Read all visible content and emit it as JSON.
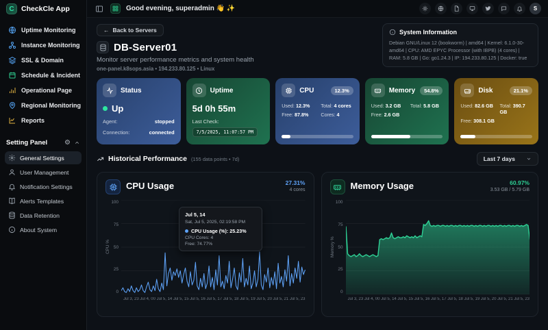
{
  "app": {
    "title": "CheckCle App"
  },
  "header": {
    "greeting": "Good evening, superadmin 👋 ✨",
    "avatar_initial": "S"
  },
  "icons": {
    "back_arrow": "←",
    "gear": "⚙"
  },
  "sidebar": {
    "items": [
      {
        "label": "Uptime Monitoring"
      },
      {
        "label": "Instance Monitoring"
      },
      {
        "label": "SSL & Domain"
      },
      {
        "label": "Schedule & Incident"
      },
      {
        "label": "Operational Page"
      },
      {
        "label": "Regional Monitoring"
      },
      {
        "label": "Reports"
      }
    ],
    "settings_label": "Setting Panel",
    "settings_items": [
      {
        "label": "General Settings"
      },
      {
        "label": "User Management"
      },
      {
        "label": "Notification Settings"
      },
      {
        "label": "Alerts Templates"
      },
      {
        "label": "Data Retention"
      },
      {
        "label": "About System"
      }
    ]
  },
  "page": {
    "back_button": "Back to Servers",
    "title": "DB-Server01",
    "subtitle": "Monitor server performance metrics and system health",
    "meta": "one-panel.k8sops.asia • 194.233.80.125 • Linux"
  },
  "system_info": {
    "title": "System Information",
    "body": "Debian GNU/Linux 12 (bookworm) | amd64 | Kernel: 6.1.0-30-amd64 | CPU: AMD EPYC Processor (with IBPB) (4 cores) | RAM: 5.8 GB | Go: go1.24.3 | IP: 194.233.80.125 | Docker: true"
  },
  "cards": {
    "status": {
      "title": "Status",
      "value": "Up",
      "agent_label": "Agent:",
      "agent": "stopped",
      "connection_label": "Connection:",
      "connection": "connected"
    },
    "uptime": {
      "title": "Uptime",
      "value": "5d 0h 55m",
      "last_check_label": "Last Check:",
      "last_check": "7/5/2025, 11:07:57 PM"
    },
    "cpu": {
      "title": "CPU",
      "badge": "12.3%",
      "used_label": "Used:",
      "used": "12.3%",
      "total_label": "Total:",
      "total": "4 cores",
      "free_label": "Free:",
      "free": "87.8%",
      "cores_label": "Cores:",
      "cores": "4",
      "progress_pct": 12.3
    },
    "memory": {
      "title": "Memory",
      "badge": "54.8%",
      "used_label": "Used:",
      "used": "3.2 GB",
      "total_label": "Total:",
      "total": "5.8 GB",
      "free_label": "Free:",
      "free": "2.6 GB",
      "progress_pct": 54.8
    },
    "disk": {
      "title": "Disk",
      "badge": "21.1%",
      "used_label": "Used:",
      "used": "82.6 GB",
      "total_label": "Total:",
      "total": "390.7 GB",
      "free_label": "Free:",
      "free": "308.1 GB",
      "progress_pct": 21.1
    }
  },
  "history": {
    "title": "Historical Performance",
    "meta": "(155 data points • 7d)",
    "range_selector": "Last 7 days"
  },
  "colors": {
    "accent_green": "#2ecc8f",
    "cpu_line": "#5ea2f7",
    "memory_line": "#2ecf94"
  },
  "chart_data": [
    {
      "type": "line",
      "title": "CPU Usage",
      "stat": "27.31%",
      "substat": "4 cores",
      "ylabel": "CPU %",
      "ylim": [
        0,
        100
      ],
      "yticks": [
        100,
        75,
        50,
        25,
        0
      ],
      "x_ticks": [
        "Jul 3, 23",
        "Jul 4, 00",
        "Jul 5, 14",
        "Jul 5, 15",
        "Jul 5, 16",
        "Jul 5, 17",
        "Jul 5, 18",
        "Jul 5, 19",
        "Jul 5, 20",
        "Jul 5, 21",
        "Jul 5, 23"
      ],
      "color": "#5ea2f7",
      "grid": true,
      "legend": "none",
      "values": [
        4,
        7,
        3,
        2,
        6,
        3,
        9,
        4,
        2,
        7,
        3,
        5,
        10,
        4,
        2,
        8,
        13,
        5,
        3,
        9,
        4,
        16,
        6,
        3,
        12,
        5,
        44,
        9,
        22,
        28,
        15,
        24,
        20,
        27,
        18,
        25,
        12,
        21,
        28,
        14,
        8,
        24,
        10,
        15,
        34,
        9,
        5,
        17,
        8,
        22,
        6,
        12,
        30,
        8,
        18,
        5,
        26,
        10,
        41,
        8,
        14,
        6,
        20,
        12,
        35,
        7,
        16,
        28,
        9,
        5,
        23,
        13,
        38,
        8,
        17,
        10,
        30,
        6,
        12,
        25,
        8,
        16,
        45,
        10,
        5,
        21,
        13,
        28,
        7,
        18,
        10,
        24,
        6,
        33,
        12,
        19,
        8,
        26,
        14,
        41,
        9,
        22,
        12,
        28,
        17,
        35,
        13,
        29,
        21,
        26
      ],
      "tooltip": {
        "title": "Jul 5, 14",
        "date": "Sat, Jul 5, 2025, 02:19:58 PM",
        "main": "CPU Usage (%): 25.23%",
        "line2": "CPU Cores: 4",
        "line3": "Free: 74.77%"
      }
    },
    {
      "type": "area",
      "title": "Memory Usage",
      "stat": "60.97%",
      "substat": "3.53 GB / 5.79 GB",
      "ylabel": "Memory %",
      "ylim": [
        0,
        100
      ],
      "yticks": [
        100,
        75,
        50,
        25,
        0
      ],
      "x_ticks": [
        "Jul 3, 23",
        "Jul 4, 00",
        "Jul 5, 14",
        "Jul 5, 15",
        "Jul 5, 16",
        "Jul 5, 17",
        "Jul 5, 18",
        "Jul 5, 19",
        "Jul 5, 20",
        "Jul 5, 21",
        "Jul 5, 23"
      ],
      "color": "#2ecf94",
      "grid": true,
      "legend": "none",
      "values": [
        72,
        43,
        41,
        40,
        41,
        42,
        40,
        41,
        43,
        41,
        40,
        41,
        42,
        41,
        40,
        41,
        42,
        41,
        40,
        41,
        58,
        59,
        58,
        59,
        60,
        59,
        60,
        65,
        60,
        59,
        60,
        61,
        60,
        60,
        61,
        60,
        62,
        61,
        60,
        61,
        60,
        62,
        60,
        61,
        62,
        61,
        74,
        73,
        75,
        78,
        73,
        72,
        73,
        72,
        73,
        73,
        72,
        73,
        73,
        72,
        73,
        72,
        73,
        73,
        72,
        73,
        72,
        73,
        73,
        72,
        73,
        72,
        73,
        72,
        73,
        73,
        72,
        73,
        72,
        73,
        73,
        72,
        73,
        72,
        73,
        73,
        72,
        73,
        72,
        73,
        72,
        73,
        73,
        72,
        73,
        72,
        73,
        73,
        72,
        73,
        72,
        73,
        73,
        72,
        73,
        72,
        73,
        74,
        73,
        58
      ]
    }
  ]
}
